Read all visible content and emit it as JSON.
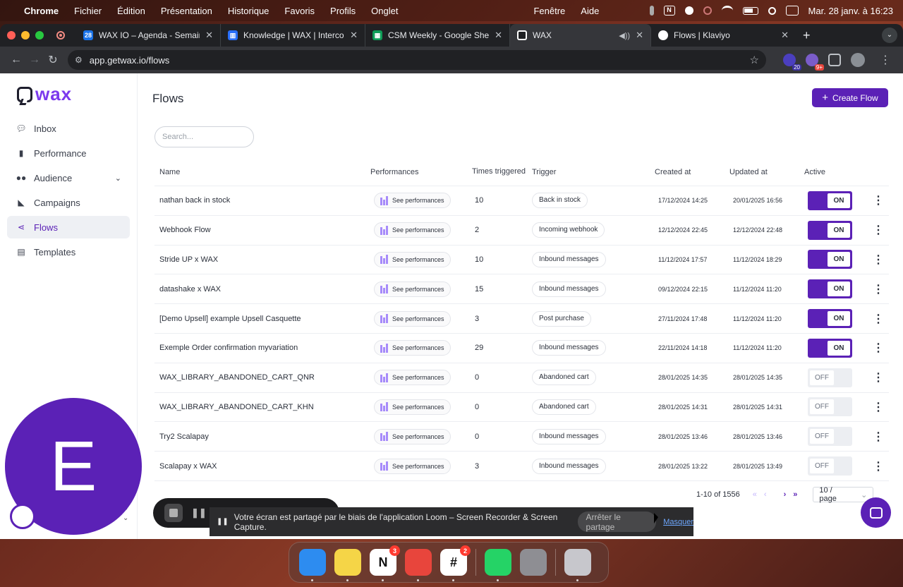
{
  "menubar": {
    "app": "Chrome",
    "items": [
      "Fichier",
      "Édition",
      "Présentation",
      "Historique",
      "Favoris",
      "Profils",
      "Onglet"
    ],
    "right_items": [
      "Fenêtre",
      "Aide"
    ],
    "clock": "Mar. 28 janv. à 16:23"
  },
  "browser": {
    "tabs": [
      {
        "label": "WAX IO – Agenda - Semaine",
        "icon": "calendar-icon",
        "color": "#1a73e8"
      },
      {
        "label": "Knowledge | WAX | Intercom",
        "icon": "intercom-icon",
        "color": "#286efa"
      },
      {
        "label": "CSM Weekly - Google Sheets",
        "icon": "sheets-icon",
        "color": "#0f9d58"
      },
      {
        "label": "WAX",
        "icon": "wax-icon",
        "color": "#5b21b6"
      },
      {
        "label": "Flows | Klaviyo",
        "icon": "klaviyo-icon",
        "color": "#ffffff"
      }
    ],
    "active_tab": 3,
    "url": "app.getwax.io/flows",
    "ext_badges": [
      "20",
      "9+"
    ]
  },
  "sidebar": {
    "logo": "wax",
    "items": [
      {
        "label": "Inbox",
        "icon": "chat-icon"
      },
      {
        "label": "Performance",
        "icon": "bar-chart-icon"
      },
      {
        "label": "Audience",
        "icon": "users-icon"
      },
      {
        "label": "Campaigns",
        "icon": "megaphone-icon"
      },
      {
        "label": "Flows",
        "icon": "flow-icon"
      },
      {
        "label": "Templates",
        "icon": "template-icon"
      }
    ]
  },
  "main": {
    "title": "Flows",
    "create_label": "Create Flow",
    "search_placeholder": "Search...",
    "headers": {
      "name": "Name",
      "performances": "Performances",
      "times": "Times triggered",
      "trigger": "Trigger",
      "created": "Created at",
      "updated": "Updated at",
      "active": "Active"
    },
    "perf_label": "See performances",
    "rows": [
      {
        "name": "nathan back in stock",
        "times": "10",
        "trigger": "Back in stock",
        "created": "17/12/2024 14:25",
        "updated": "20/01/2025 16:56",
        "state": "ON"
      },
      {
        "name": "Webhook Flow",
        "times": "2",
        "trigger": "Incoming webhook",
        "created": "12/12/2024 22:45",
        "updated": "12/12/2024 22:48",
        "state": "ON"
      },
      {
        "name": "Stride UP x WAX",
        "times": "10",
        "trigger": "Inbound messages",
        "created": "11/12/2024 17:57",
        "updated": "11/12/2024 18:29",
        "state": "ON"
      },
      {
        "name": "datashake x WAX",
        "times": "15",
        "trigger": "Inbound messages",
        "created": "09/12/2024 22:15",
        "updated": "11/12/2024 11:20",
        "state": "ON"
      },
      {
        "name": "[Demo Upsell] example Upsell Casquette",
        "times": "3",
        "trigger": "Post purchase",
        "created": "27/11/2024 17:48",
        "updated": "11/12/2024 11:20",
        "state": "ON"
      },
      {
        "name": "Exemple Order confirmation myvariation",
        "times": "29",
        "trigger": "Inbound messages",
        "created": "22/11/2024 14:18",
        "updated": "11/12/2024 11:20",
        "state": "ON"
      },
      {
        "name": "WAX_LIBRARY_ABANDONED_CART_QNR",
        "times": "0",
        "trigger": "Abandoned cart",
        "created": "28/01/2025 14:35",
        "updated": "28/01/2025 14:35",
        "state": "OFF"
      },
      {
        "name": "WAX_LIBRARY_ABANDONED_CART_KHN",
        "times": "0",
        "trigger": "Abandoned cart",
        "created": "28/01/2025 14:31",
        "updated": "28/01/2025 14:31",
        "state": "OFF"
      },
      {
        "name": "Try2 Scalapay",
        "times": "0",
        "trigger": "Inbound messages",
        "created": "28/01/2025 13:46",
        "updated": "28/01/2025 13:46",
        "state": "OFF"
      },
      {
        "name": "Scalapay x WAX",
        "times": "3",
        "trigger": "Inbound messages",
        "created": "28/01/2025 13:22",
        "updated": "28/01/2025 13:49",
        "state": "OFF"
      }
    ],
    "pagination": {
      "range": "1-10 of 1556",
      "page_size": "10 / page"
    }
  },
  "overlay": {
    "avatar_letter": "E",
    "share_text": "Votre écran est partagé par le biais de l'application Loom – Screen Recorder & Screen Capture.",
    "stop_label": "Arrêter le partage",
    "hide_label": "Masquer"
  },
  "dock": {
    "apps": [
      {
        "name": "finder",
        "color": "#2d8cf0",
        "glyph": ""
      },
      {
        "name": "notes",
        "color": "#f5d547",
        "glyph": ""
      },
      {
        "name": "notion",
        "color": "#ffffff",
        "glyph": "N",
        "badge": "3"
      },
      {
        "name": "chrome",
        "color": "#e8453c",
        "glyph": ""
      },
      {
        "name": "slack",
        "color": "#ffffff",
        "glyph": "#",
        "badge": "2"
      },
      {
        "name": "whatsapp",
        "color": "#25d366",
        "glyph": ""
      },
      {
        "name": "system-settings",
        "color": "#8e8e93",
        "glyph": ""
      },
      {
        "name": "trash",
        "color": "#c7c7cc",
        "glyph": ""
      }
    ]
  }
}
